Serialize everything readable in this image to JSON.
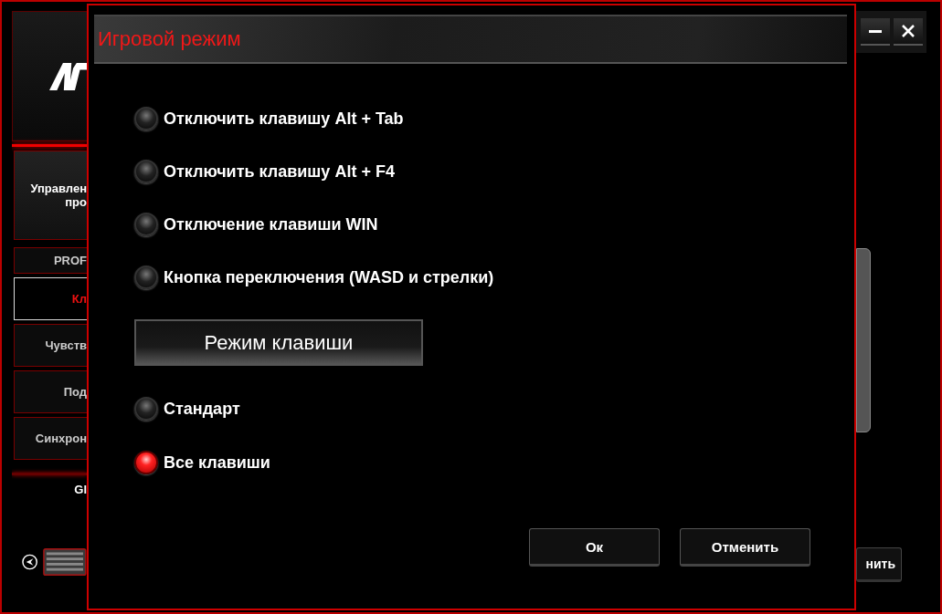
{
  "background": {
    "sidebar": {
      "items": [
        {
          "lines": [
            "Управлен",
            "про"
          ],
          "selected": false
        },
        {
          "lines": [
            "PROF"
          ],
          "selected": false
        },
        {
          "lines": [
            "Кл"
          ],
          "selected": true
        },
        {
          "lines": [
            "Чувств"
          ],
          "selected": false
        },
        {
          "lines": [
            "Под"
          ],
          "selected": false
        },
        {
          "lines": [
            "Синхрон"
          ],
          "selected": false
        }
      ],
      "device_label": "Gl"
    },
    "right_button": "нить"
  },
  "dialog": {
    "title": "Игровой режим",
    "toggles": [
      {
        "label": "Отключить клавишу Alt + Tab",
        "on": false
      },
      {
        "label": "Отключить клавишу Alt + F4",
        "on": false
      },
      {
        "label": "Отключение клавиши WIN",
        "on": false
      },
      {
        "label": "Кнопка переключения (WASD и стрелки)",
        "on": false
      }
    ],
    "section": "Режим клавиши",
    "modes": [
      {
        "label": "Стандарт",
        "selected": false
      },
      {
        "label": "Все клавиши",
        "selected": true
      }
    ],
    "buttons": [
      "Ок",
      "Отменить"
    ]
  }
}
